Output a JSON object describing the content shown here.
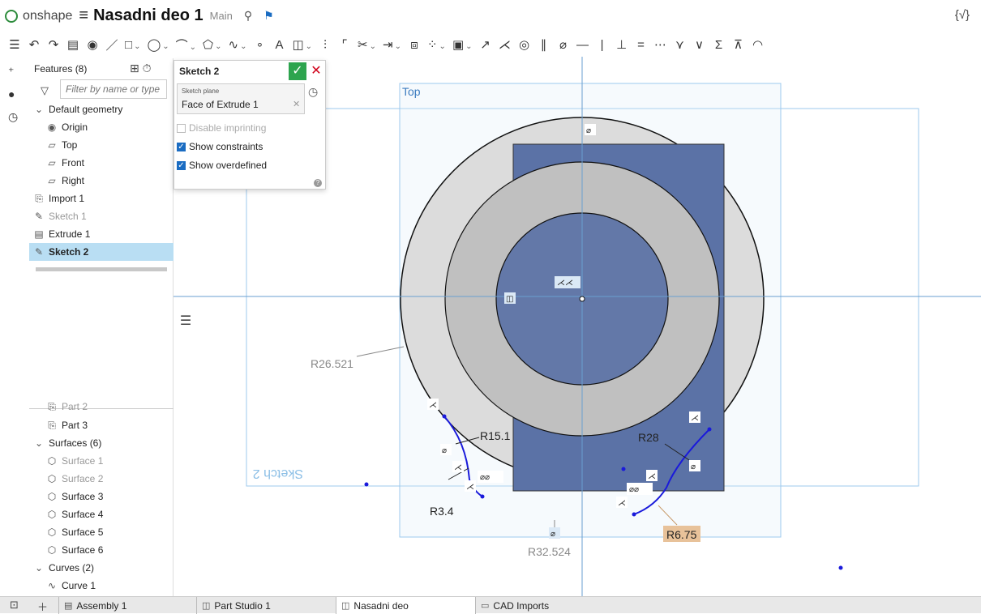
{
  "header": {
    "brand": "onshape",
    "menu_icon": "hamburger-icon",
    "doc_title": "Nasadni deo 1",
    "branch": "Main",
    "variables_icon": "variable-studio-icon"
  },
  "toolbar": {
    "icons": [
      "feature-list-icon",
      "undo-icon",
      "redo-icon",
      "part-studio-icon",
      "render-icon",
      "line-icon",
      "rectangle-icon",
      "circle-icon",
      "arc-icon",
      "polygon-icon",
      "spline-icon",
      "point-icon",
      "text-icon",
      "image-icon",
      "mirror-icon",
      "fillet-icon",
      "trim-icon",
      "extend-icon",
      "offset-icon",
      "pattern-icon",
      "dxf-icon",
      "use-icon",
      "coincident-icon",
      "concentric-icon",
      "parallel-icon",
      "tangent-icon",
      "horizontal-icon",
      "vertical-icon",
      "perpendicular-icon",
      "equal-icon",
      "midpoint-icon",
      "normal-icon",
      "pierce-icon",
      "symmetric-icon",
      "fix-icon",
      "curvature-icon"
    ]
  },
  "features": {
    "header": "Features (8)",
    "filter_placeholder": "Filter by name or type",
    "items": [
      {
        "label": "Default geometry",
        "kind": "group"
      },
      {
        "label": "Origin",
        "kind": "origin"
      },
      {
        "label": "Top",
        "kind": "plane"
      },
      {
        "label": "Front",
        "kind": "plane"
      },
      {
        "label": "Right",
        "kind": "plane"
      },
      {
        "label": "Import 1",
        "kind": "import"
      },
      {
        "label": "Sketch 1",
        "kind": "sketch"
      },
      {
        "label": "Extrude 1",
        "kind": "extrude"
      },
      {
        "label": "Sketch 2",
        "kind": "sketch"
      }
    ],
    "parts": [
      {
        "label": "Part 2"
      },
      {
        "label": "Part 3"
      },
      {
        "label": "Surfaces (6)"
      },
      {
        "label": "Surface 1"
      },
      {
        "label": "Surface 2"
      },
      {
        "label": "Surface 3"
      },
      {
        "label": "Surface 4"
      },
      {
        "label": "Surface 5"
      },
      {
        "label": "Surface 6"
      },
      {
        "label": "Curves (2)"
      },
      {
        "label": "Curve 1"
      }
    ]
  },
  "sketch_dialog": {
    "title": "Sketch 2",
    "plane_label": "Sketch plane",
    "plane_value": "Face of Extrude 1",
    "disable_imprinting": "Disable imprinting",
    "show_constraints": "Show constraints",
    "show_overdefined": "Show overdefined"
  },
  "viewport": {
    "plane_top_label": "Top",
    "sketch_label": "Sketch 2",
    "dims": {
      "r_outer": "R26.521",
      "r_15": "R15.1",
      "r_28": "R28",
      "r_34": "R3.4",
      "r_675": "R6.75",
      "r_32": "R32.524"
    },
    "colors": {
      "extrude": "#5b72a6",
      "ring": "#c0c0c0",
      "outer": "#dcdcdc",
      "sketch_curve": "#1a1adb",
      "plane": "#9cc9ee",
      "dim_highlight": "#e8c29a"
    }
  },
  "tabs": [
    {
      "label": "Assembly 1",
      "icon": "assembly-icon"
    },
    {
      "label": "Part Studio 1",
      "icon": "part-studio-icon"
    },
    {
      "label": "Nasadni deo",
      "icon": "part-studio-icon"
    },
    {
      "label": "CAD Imports",
      "icon": "folder-icon"
    }
  ]
}
